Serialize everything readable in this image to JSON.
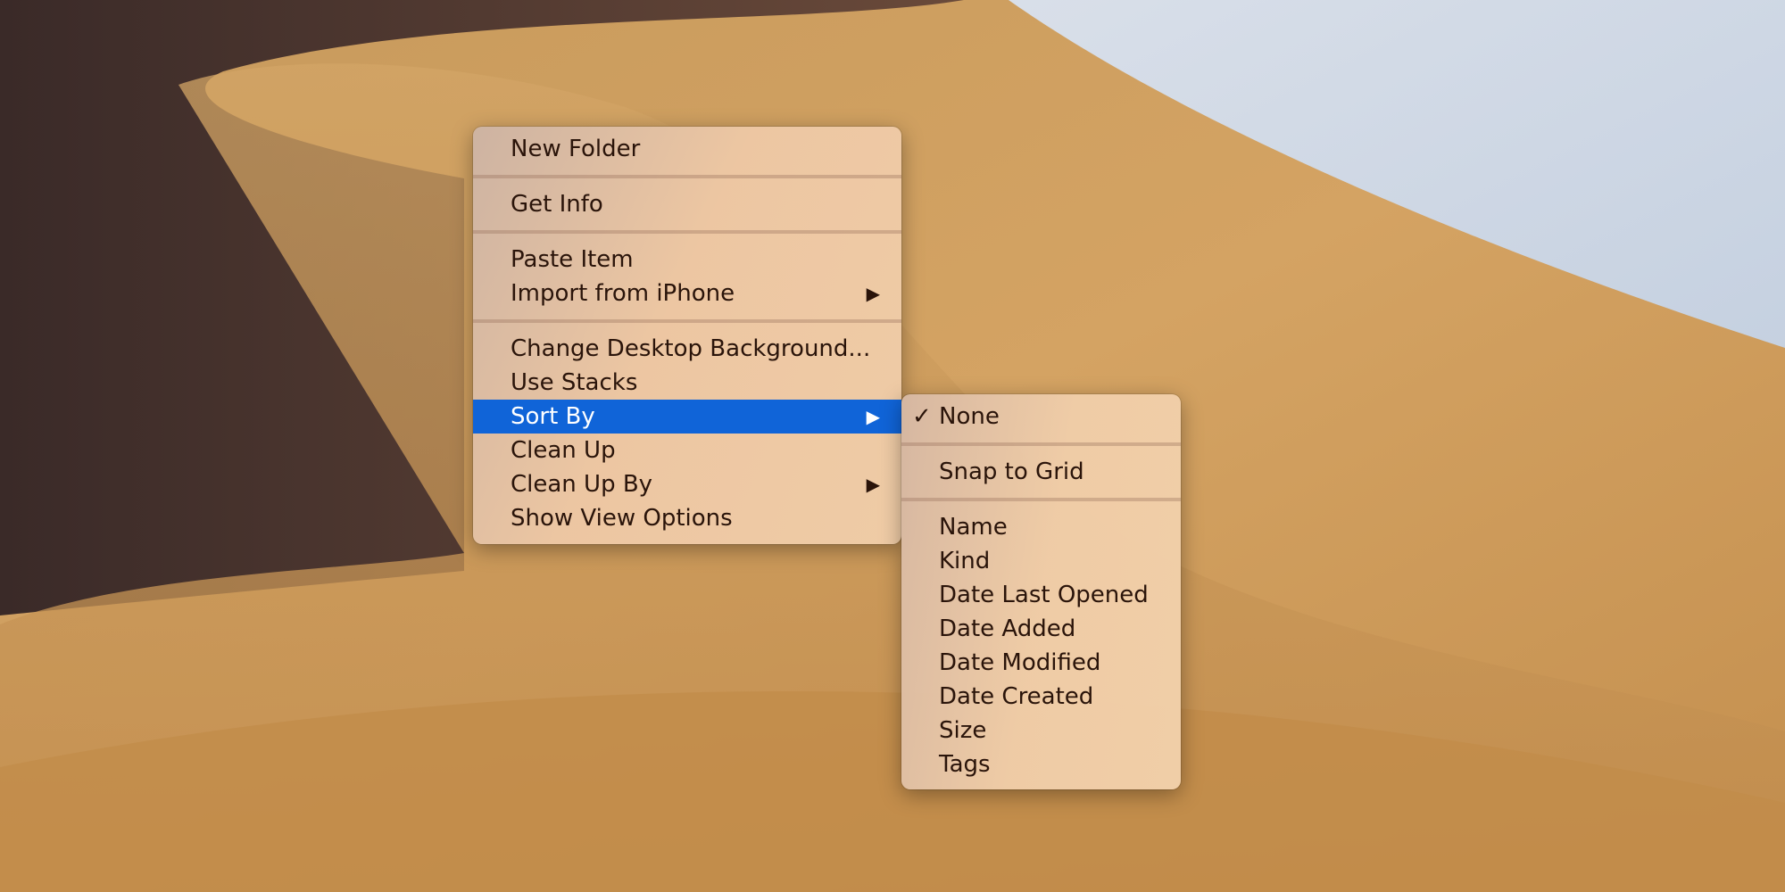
{
  "desktop": {
    "wallpaper": "Mojave desert dunes"
  },
  "main_menu": {
    "groups": [
      [
        {
          "label": "New Folder"
        }
      ],
      [
        {
          "label": "Get Info"
        }
      ],
      [
        {
          "label": "Paste Item"
        },
        {
          "label": "Import from iPhone",
          "submenu": true
        }
      ],
      [
        {
          "label": "Change Desktop Background…"
        },
        {
          "label": "Use Stacks"
        },
        {
          "label": "Sort By",
          "submenu": true,
          "highlighted": true
        },
        {
          "label": "Clean Up"
        },
        {
          "label": "Clean Up By",
          "submenu": true
        },
        {
          "label": "Show View Options"
        }
      ]
    ]
  },
  "items": {
    "new_folder": "New Folder",
    "get_info": "Get Info",
    "paste_item": "Paste Item",
    "import_iphone": "Import from iPhone",
    "change_bg": "Change Desktop Background...",
    "use_stacks": "Use Stacks",
    "sort_by": "Sort By",
    "clean_up": "Clean Up",
    "clean_up_by": "Clean Up By",
    "show_view_options": "Show View Options"
  },
  "submenu": {
    "none": "None",
    "snap_to_grid": "Snap to Grid",
    "name": "Name",
    "kind": "Kind",
    "date_last_opened": "Date Last Opened",
    "date_added": "Date Added",
    "date_modified": "Date Modified",
    "date_created": "Date Created",
    "size": "Size",
    "tags": "Tags",
    "checked": "None"
  },
  "glyphs": {
    "arrow": "▶",
    "check": "✓"
  },
  "colors": {
    "highlight": "#1064d8",
    "text": "#2a140a"
  }
}
